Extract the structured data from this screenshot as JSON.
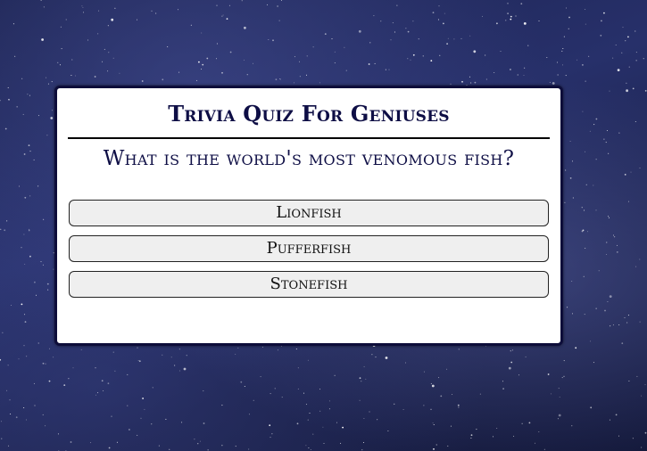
{
  "quiz": {
    "title": "Trivia Quiz For Geniuses",
    "question": "What is the world's most venomous fish?",
    "answers": [
      {
        "label": "Lionfish"
      },
      {
        "label": "Pufferfish"
      },
      {
        "label": "Stonefish"
      }
    ]
  },
  "colors": {
    "title_color": "#0e0e45",
    "card_border": "#0d0d3a",
    "button_background": "#efefef",
    "background_sky": "#1c2350"
  }
}
